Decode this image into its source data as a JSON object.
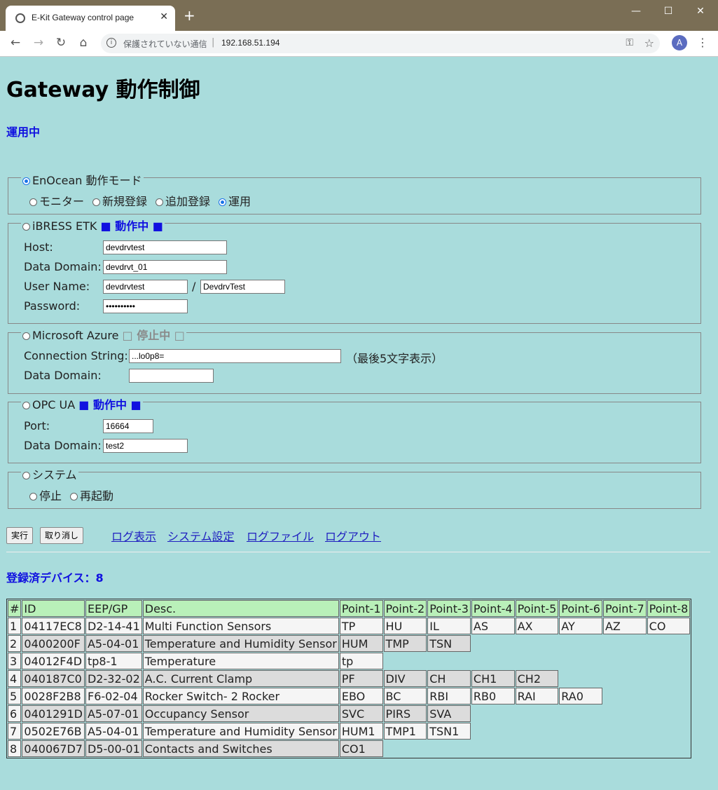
{
  "browser": {
    "tab_title": "E-Kit Gateway control page",
    "security": "保護されていない通信",
    "url": "192.168.51.194",
    "avatar": "A"
  },
  "page": {
    "title": "Gateway 動作制御",
    "status": "運用中"
  },
  "enocean": {
    "legend": "EnOcean 動作モード",
    "selected": true,
    "modes": [
      {
        "label": "モニター",
        "selected": false
      },
      {
        "label": "新規登録",
        "selected": false
      },
      {
        "label": "追加登録",
        "selected": false
      },
      {
        "label": "運用",
        "selected": true
      }
    ]
  },
  "ibress": {
    "legend": "iBRESS ETK",
    "state": "■ 動作中 ■",
    "host_label": "Host:",
    "host": "devdrvtest",
    "domain_label": "Data Domain:",
    "domain": "devdrvt_01",
    "user_label": "User Name:",
    "user": "devdrvtest",
    "slash": "/",
    "user2": "DevdrvTest",
    "password_label": "Password:",
    "password": "••••••••••"
  },
  "azure": {
    "legend": "Microsoft Azure",
    "state": "□ 停止中 □",
    "conn_label": "Connection String:",
    "conn": "...lo0p8=",
    "conn_note": "（最後5文字表示）",
    "domain_label": "Data Domain:",
    "domain": ""
  },
  "opcua": {
    "legend": "OPC UA",
    "state": "■ 動作中 ■",
    "port_label": "Port:",
    "port": "16664",
    "domain_label": "Data Domain:",
    "domain": "test2"
  },
  "system": {
    "legend": "システム",
    "options": [
      {
        "label": "停止",
        "selected": false
      },
      {
        "label": "再起動",
        "selected": false
      }
    ]
  },
  "actions": {
    "execute": "実行",
    "cancel": "取り消し",
    "links": [
      "ログ表示",
      "システム設定",
      "ログファイル",
      "ログアウト"
    ]
  },
  "devices": {
    "heading": "登録済デバイス：8",
    "columns": [
      "#",
      "ID",
      "EEP/GP",
      "Desc.",
      "Point-1",
      "Point-2",
      "Point-3",
      "Point-4",
      "Point-5",
      "Point-6",
      "Point-7",
      "Point-8"
    ],
    "rows": [
      [
        "1",
        "04117EC8",
        "D2-14-41",
        "Multi Function Sensors",
        "TP",
        "HU",
        "IL",
        "AS",
        "AX",
        "AY",
        "AZ",
        "CO"
      ],
      [
        "2",
        "0400200F",
        "A5-04-01",
        "Temperature and Humidity Sensor",
        "HUM",
        "TMP",
        "TSN"
      ],
      [
        "3",
        "04012F4D",
        "tp8-1",
        "Temperature",
        "tp"
      ],
      [
        "4",
        "040187C0",
        "D2-32-02",
        "A.C. Current Clamp",
        "PF",
        "DIV",
        "CH",
        "CH1",
        "CH2"
      ],
      [
        "5",
        "0028F2B8",
        "F6-02-04",
        "Rocker Switch- 2 Rocker",
        "EBO",
        "BC",
        "RBI",
        "RB0",
        "RAI",
        "RA0"
      ],
      [
        "6",
        "0401291D",
        "A5-07-01",
        "Occupancy Sensor",
        "SVC",
        "PIRS",
        "SVA"
      ],
      [
        "7",
        "0502E76B",
        "A5-04-01",
        "Temperature and Humidity Sensor",
        "HUM1",
        "TMP1",
        "TSN1"
      ],
      [
        "8",
        "040067D7",
        "D5-00-01",
        "Contacts and Switches",
        "CO1"
      ]
    ]
  }
}
